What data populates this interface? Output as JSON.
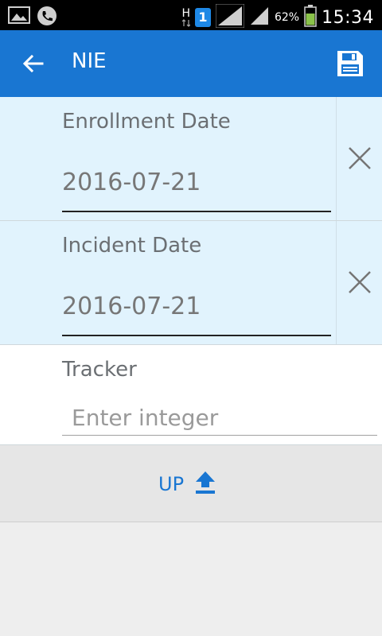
{
  "status_bar": {
    "network_type": "H",
    "sim_badge": "1",
    "battery_percent": "62%",
    "time": "15:34"
  },
  "toolbar": {
    "title": "NIE"
  },
  "enrollment": {
    "label": "Enrollment Date",
    "value": "2016-07-21"
  },
  "incident": {
    "label": "Incident Date",
    "value": "2016-07-21"
  },
  "tracker": {
    "label": "Tracker",
    "placeholder": "Enter integer"
  },
  "up_button": {
    "label": "UP"
  },
  "colors": {
    "primary": "#1976d2",
    "row_bg": "#e1f3fd"
  }
}
